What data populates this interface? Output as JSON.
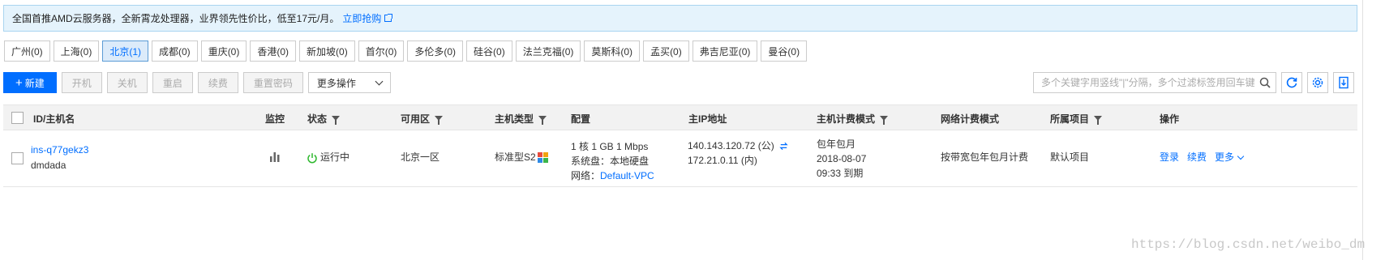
{
  "notice": {
    "text": "全国首推AMD云服务器，全新霄龙处理器，业界领先性价比，低至17元/月。",
    "link": "立即抢购"
  },
  "regions": [
    {
      "label": "广州(0)",
      "active": false
    },
    {
      "label": "上海(0)",
      "active": false
    },
    {
      "label": "北京(1)",
      "active": true
    },
    {
      "label": "成都(0)",
      "active": false
    },
    {
      "label": "重庆(0)",
      "active": false
    },
    {
      "label": "香港(0)",
      "active": false
    },
    {
      "label": "新加坡(0)",
      "active": false
    },
    {
      "label": "首尔(0)",
      "active": false
    },
    {
      "label": "多伦多(0)",
      "active": false
    },
    {
      "label": "硅谷(0)",
      "active": false
    },
    {
      "label": "法兰克福(0)",
      "active": false
    },
    {
      "label": "莫斯科(0)",
      "active": false
    },
    {
      "label": "孟买(0)",
      "active": false
    },
    {
      "label": "弗吉尼亚(0)",
      "active": false
    },
    {
      "label": "曼谷(0)",
      "active": false
    }
  ],
  "toolbar": {
    "new": "新建",
    "start": "开机",
    "shutdown": "关机",
    "restart": "重启",
    "renew": "续费",
    "reset_password": "重置密码",
    "more_ops": "更多操作"
  },
  "search": {
    "placeholder": "多个关键字用竖线\"|\"分隔，多个过滤标签用回车键分隔"
  },
  "table": {
    "headers": {
      "id": "ID/主机名",
      "monitor": "监控",
      "status": "状态",
      "zone": "可用区",
      "type": "主机类型",
      "config": "配置",
      "ip": "主IP地址",
      "billing": "主机计费模式",
      "net_billing": "网络计费模式",
      "project": "所属项目",
      "actions": "操作"
    },
    "rows": [
      {
        "id": "ins-q77gekz3",
        "hostname": "dmdada",
        "status": "运行中",
        "zone": "北京一区",
        "type": "标准型S2",
        "config_line1": "1 核 1 GB 1 Mbps",
        "config_line2": "系统盘：本地硬盘",
        "config_line3_label": "网络：",
        "config_line3_link": "Default-VPC",
        "ip_public": "140.143.120.72 (公)",
        "ip_private": "172.21.0.11 (内)",
        "billing_mode": "包年包月",
        "billing_date": "2018-08-07",
        "billing_expire": "09:33 到期",
        "net_billing": "按带宽包年包月计费",
        "project": "默认项目",
        "action_login": "登录",
        "action_renew": "续费",
        "action_more": "更多"
      }
    ]
  },
  "watermark": "https://blog.csdn.net/weibo_dm",
  "colors": {
    "accent": "#006eff",
    "running": "#2eb82e",
    "notice_bg": "#e5f3fc"
  }
}
